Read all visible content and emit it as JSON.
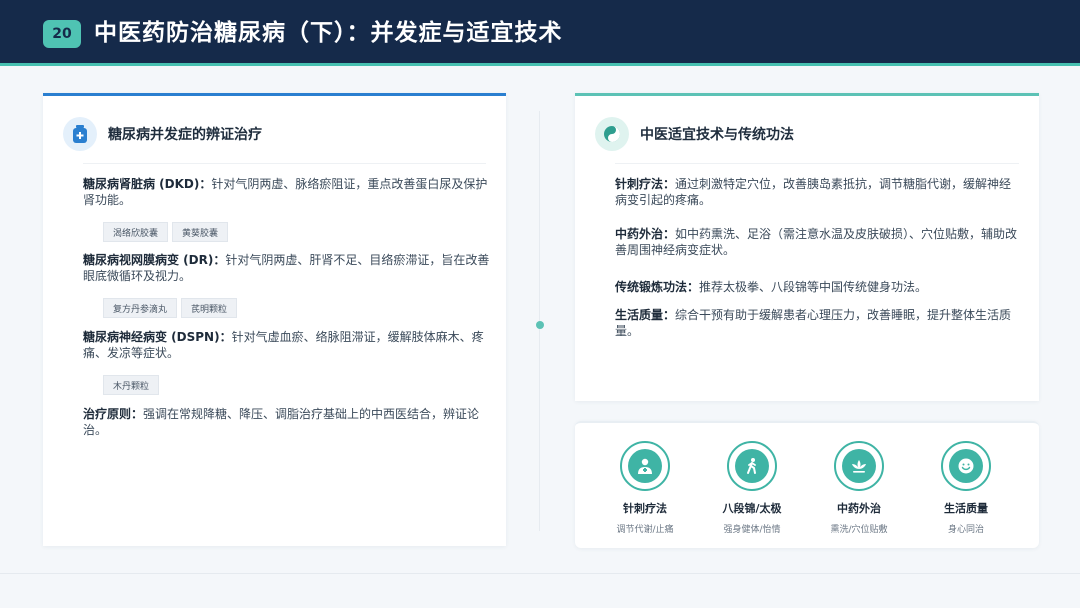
{
  "header": {
    "page_number": "20",
    "title": "中医药防治糖尿病（下）：并发症与适宜技术"
  },
  "left_card": {
    "icon": "medicine-bottle-icon",
    "title": "糖尿病并发症的辨证治疗",
    "items": [
      {
        "term": "糖尿病肾脏病 (DKD)：",
        "text": "针对气阴两虚、脉络瘀阻证，重点改善蛋白尿及保护肾功能。",
        "tags": [
          "渴络欣胶囊",
          "黄葵胶囊"
        ]
      },
      {
        "term": "糖尿病视网膜病变 (DR)：",
        "text": "针对气阴两虚、肝肾不足、目络瘀滞证，旨在改善眼底微循环及视力。",
        "tags": [
          "复方丹参滴丸",
          "芪明颗粒"
        ]
      },
      {
        "term": "糖尿病神经病变 (DSPN)：",
        "text": "针对气虚血瘀、络脉阻滞证，缓解肢体麻木、疼痛、发凉等症状。",
        "tags": [
          "木丹颗粒"
        ]
      },
      {
        "term": "治疗原则：",
        "text": "强调在常规降糖、降压、调脂治疗基础上的中西医结合，辨证论治。",
        "tags": []
      }
    ]
  },
  "right_card": {
    "icon": "yin-yang-icon",
    "title": "中医适宜技术与传统功法",
    "items": [
      {
        "term": "针刺疗法：",
        "text": "通过刺激特定穴位，改善胰岛素抵抗，调节糖脂代谢，缓解神经病变引起的疼痛。"
      },
      {
        "term": "中药外治：",
        "text": "如中药熏洗、足浴（需注意水温及皮肤破损）、穴位贴敷，辅助改善周围神经病变症状。"
      },
      {
        "term": "传统锻炼功法：",
        "text": "推荐太极拳、八段锦等中国传统健身功法。"
      },
      {
        "term": "生活质量：",
        "text": "综合干预有助于缓解患者心理压力，改善睡眠，提升整体生活质量。"
      }
    ]
  },
  "features": [
    {
      "icon": "doctor-icon",
      "title": "针刺疗法",
      "subtitle": "调节代谢/止痛"
    },
    {
      "icon": "walking-person-icon",
      "title": "八段锦/太极",
      "subtitle": "强身健体/怡情"
    },
    {
      "icon": "lotus-icon",
      "title": "中药外治",
      "subtitle": "熏洗/穴位贴敷"
    },
    {
      "icon": "smile-icon",
      "title": "生活质量",
      "subtitle": "身心同治"
    }
  ],
  "colors": {
    "header_bg": "#152a4a",
    "accent_teal": "#46c0b0",
    "accent_blue": "#2a7fd0"
  }
}
